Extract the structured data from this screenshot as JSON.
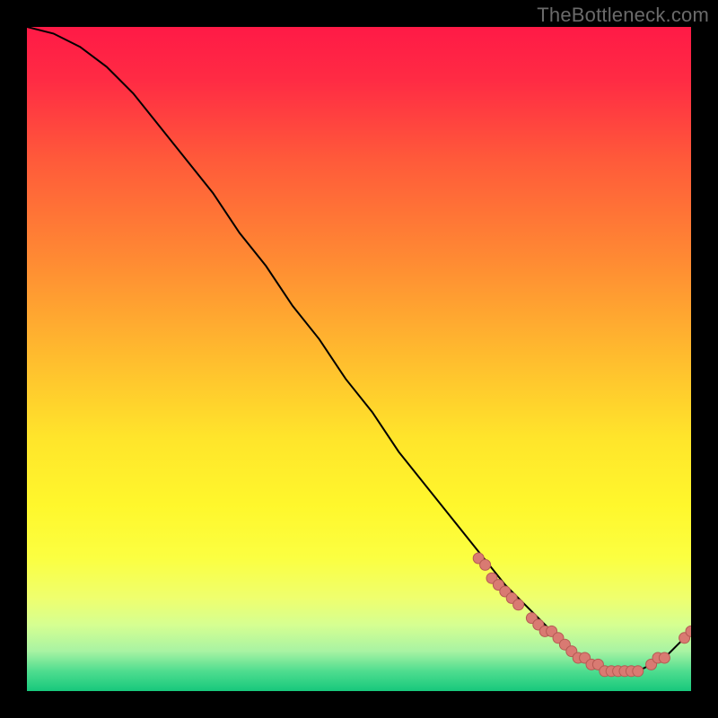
{
  "watermark": "TheBottleneck.com",
  "colors": {
    "gradient_stops": [
      {
        "offset": 0.0,
        "color": "#ff1a46"
      },
      {
        "offset": 0.08,
        "color": "#ff2b44"
      },
      {
        "offset": 0.2,
        "color": "#ff5a3a"
      },
      {
        "offset": 0.35,
        "color": "#ff8a33"
      },
      {
        "offset": 0.5,
        "color": "#ffbd2e"
      },
      {
        "offset": 0.62,
        "color": "#ffe52b"
      },
      {
        "offset": 0.72,
        "color": "#fff72c"
      },
      {
        "offset": 0.8,
        "color": "#fbff41"
      },
      {
        "offset": 0.86,
        "color": "#efff6e"
      },
      {
        "offset": 0.9,
        "color": "#d6ff91"
      },
      {
        "offset": 0.94,
        "color": "#a8f3a3"
      },
      {
        "offset": 0.97,
        "color": "#4fdd8f"
      },
      {
        "offset": 1.0,
        "color": "#17c87c"
      }
    ],
    "curve": "#000000",
    "marker_fill": "#d97a72",
    "marker_stroke": "#b55a53"
  },
  "chart_data": {
    "type": "line",
    "title": "",
    "xlabel": "",
    "ylabel": "",
    "xlim": [
      0,
      100
    ],
    "ylim": [
      0,
      100
    ],
    "series": [
      {
        "name": "bottleneck-curve",
        "x": [
          0,
          4,
          8,
          12,
          16,
          20,
          24,
          28,
          32,
          36,
          40,
          44,
          48,
          52,
          56,
          60,
          64,
          68,
          72,
          74,
          76,
          78,
          80,
          82,
          84,
          86,
          88,
          90,
          92,
          94,
          96,
          98,
          100
        ],
        "y": [
          100,
          99,
          97,
          94,
          90,
          85,
          80,
          75,
          69,
          64,
          58,
          53,
          47,
          42,
          36,
          31,
          26,
          21,
          16,
          14,
          12,
          10,
          8,
          6,
          5,
          4,
          3,
          3,
          3,
          4,
          5,
          7,
          9
        ]
      }
    ],
    "markers": {
      "name": "highlighted-points",
      "x": [
        68,
        69,
        70,
        71,
        72,
        73,
        74,
        76,
        77,
        78,
        79,
        80,
        81,
        82,
        83,
        84,
        85,
        86,
        87,
        88,
        89,
        90,
        91,
        92,
        94,
        95,
        96,
        99,
        100
      ],
      "y": [
        20,
        19,
        17,
        16,
        15,
        14,
        13,
        11,
        10,
        9,
        9,
        8,
        7,
        6,
        5,
        5,
        4,
        4,
        3,
        3,
        3,
        3,
        3,
        3,
        4,
        5,
        5,
        8,
        9
      ]
    }
  }
}
